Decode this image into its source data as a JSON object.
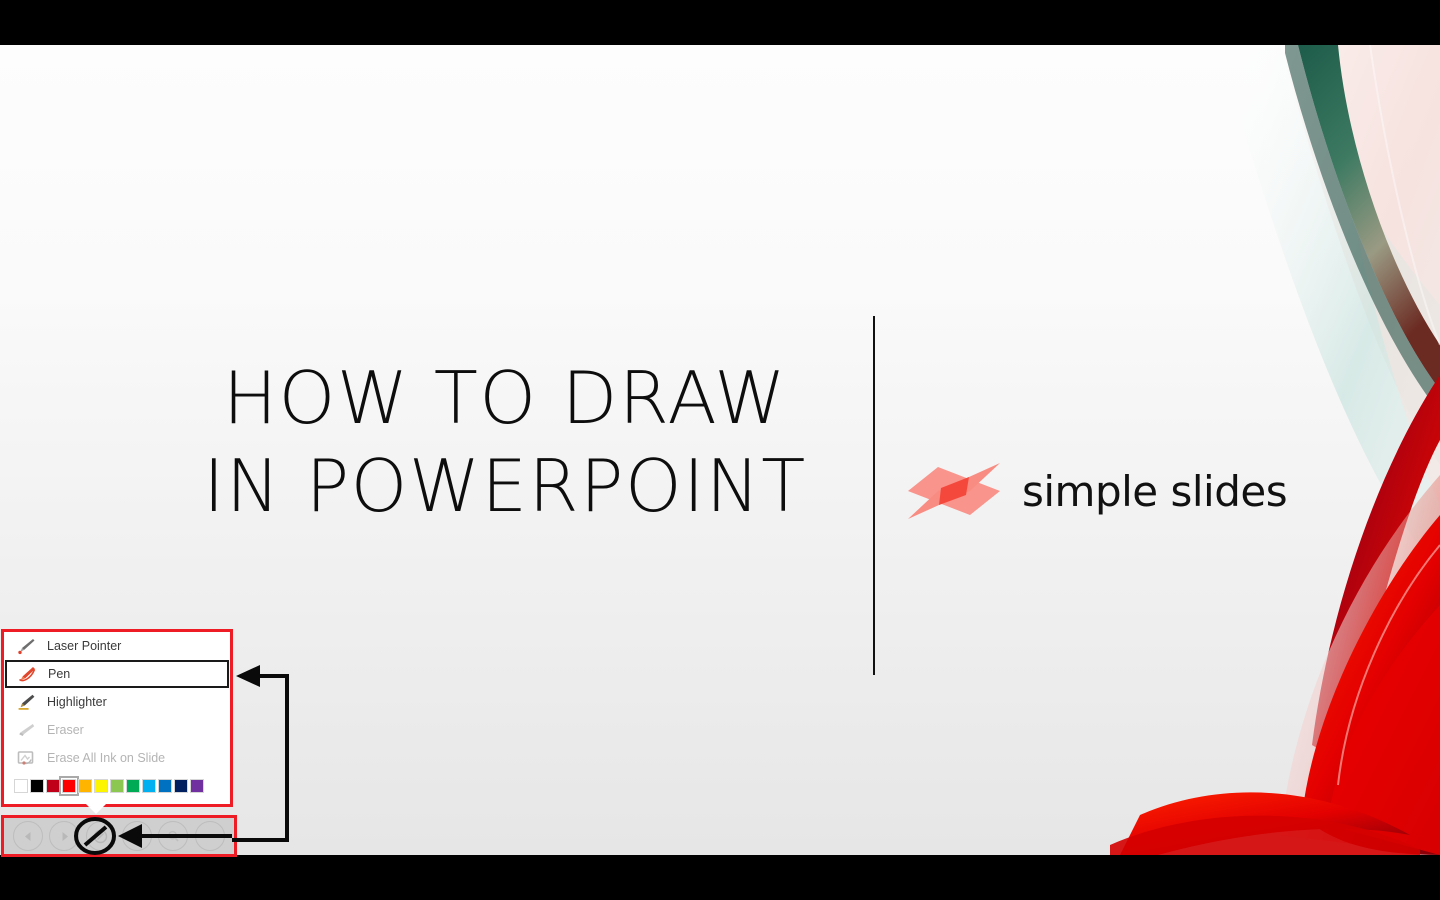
{
  "slide": {
    "title_line1": "HOW TO DRAW",
    "title_line2": "IN POWERPOINT",
    "logo_text": "simple slides",
    "background_top_color": "#fdfdfd",
    "background_bottom_color": "#e6e6e6",
    "divider_color": "#111111",
    "logo_mark_color": "#f98c82",
    "logo_mark_accent_color": "#f5483c",
    "artwork_colors": [
      "#1d5c4a",
      "#7e8f7c",
      "#c9473c",
      "#e00000",
      "#b00010"
    ]
  },
  "ink_menu": {
    "border_color": "#ee1c25",
    "items": [
      {
        "label": "Laser Pointer",
        "icon": "laser-pointer-icon",
        "state": "enabled"
      },
      {
        "label": "Pen",
        "icon": "pen-icon",
        "state": "selected"
      },
      {
        "label": "Highlighter",
        "icon": "highlighter-icon",
        "state": "enabled"
      },
      {
        "label": "Eraser",
        "icon": "eraser-icon",
        "state": "disabled"
      },
      {
        "label": "Erase All Ink on Slide",
        "icon": "erase-all-ink-icon",
        "state": "disabled"
      }
    ],
    "colors": [
      {
        "name": "White",
        "hex": "#ffffff",
        "selected": false
      },
      {
        "name": "Black",
        "hex": "#000000",
        "selected": false
      },
      {
        "name": "Dark Red",
        "hex": "#c00018",
        "selected": false
      },
      {
        "name": "Red",
        "hex": "#fe0000",
        "selected": true
      },
      {
        "name": "Orange",
        "hex": "#ffb400",
        "selected": false
      },
      {
        "name": "Yellow",
        "hex": "#fdf400",
        "selected": false
      },
      {
        "name": "Light Green",
        "hex": "#8cc751",
        "selected": false
      },
      {
        "name": "Green",
        "hex": "#00ab55",
        "selected": false
      },
      {
        "name": "Light Blue",
        "hex": "#00b0f0",
        "selected": false
      },
      {
        "name": "Blue",
        "hex": "#0070c0",
        "selected": false
      },
      {
        "name": "Dark Blue",
        "hex": "#012060",
        "selected": false
      },
      {
        "name": "Purple",
        "hex": "#7030a0",
        "selected": false
      }
    ]
  },
  "toolbar": {
    "border_color": "#ee1c25",
    "background": "#cfcfcf",
    "buttons": [
      {
        "name": "previous-slide",
        "icon": "chevron-left-icon",
        "label": "Previous"
      },
      {
        "name": "next-slide",
        "icon": "chevron-right-icon",
        "label": "Next"
      },
      {
        "name": "ink-tools",
        "icon": "pen-circle-icon",
        "label": "Pen and laser pointer tools"
      },
      {
        "name": "all-slides",
        "icon": "grid-slides-icon",
        "label": "See all slides"
      },
      {
        "name": "zoom-in",
        "icon": "magnifier-icon",
        "label": "Zoom into the slide"
      },
      {
        "name": "more-options",
        "icon": "ellipsis-icon",
        "label": "More slide show options"
      }
    ]
  }
}
